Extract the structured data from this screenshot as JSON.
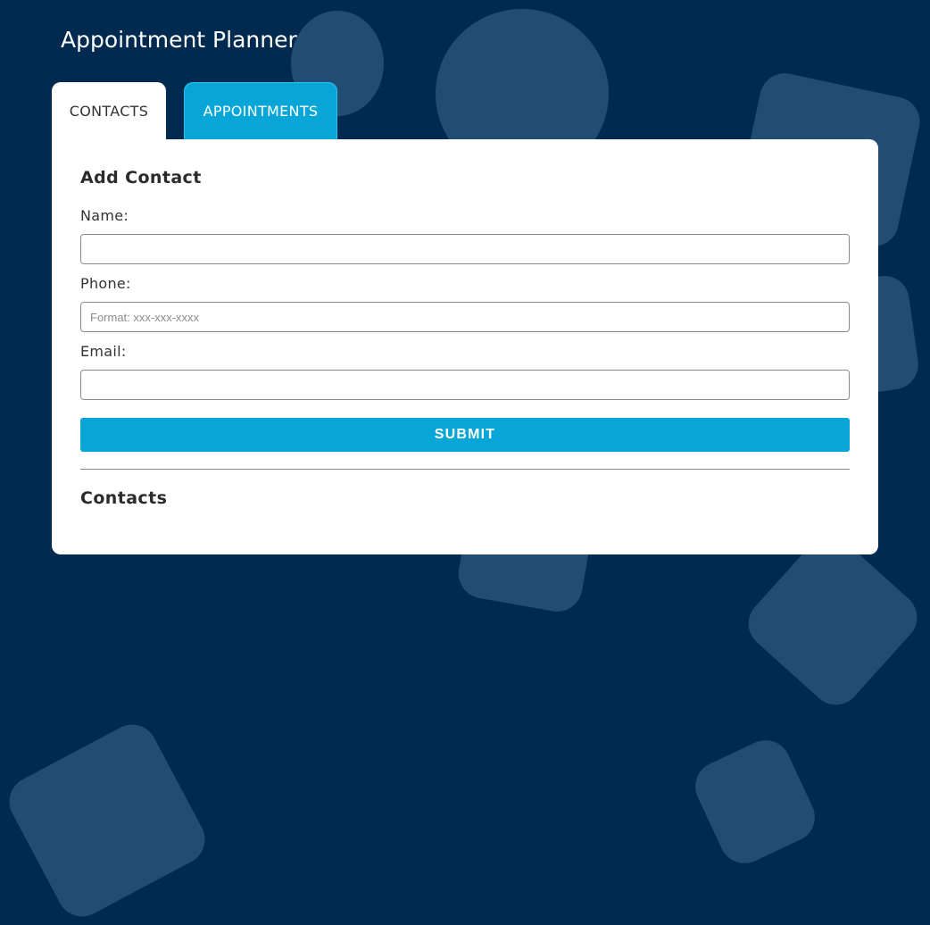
{
  "app": {
    "title": "Appointment Planner"
  },
  "tabs": [
    {
      "label": "CONTACTS",
      "active": true
    },
    {
      "label": "APPOINTMENTS",
      "active": false
    }
  ],
  "add_contact": {
    "heading": "Add Contact",
    "fields": {
      "name": {
        "label": "Name:",
        "value": "",
        "placeholder": ""
      },
      "phone": {
        "label": "Phone:",
        "value": "",
        "placeholder": "Format: xxx-xxx-xxxx"
      },
      "email": {
        "label": "Email:",
        "value": "",
        "placeholder": ""
      }
    },
    "submit_label": "SUBMIT"
  },
  "contacts": {
    "heading": "Contacts",
    "items": []
  },
  "colors": {
    "background": "#002a50",
    "accent": "#08a6d6",
    "panel": "#ffffff"
  }
}
